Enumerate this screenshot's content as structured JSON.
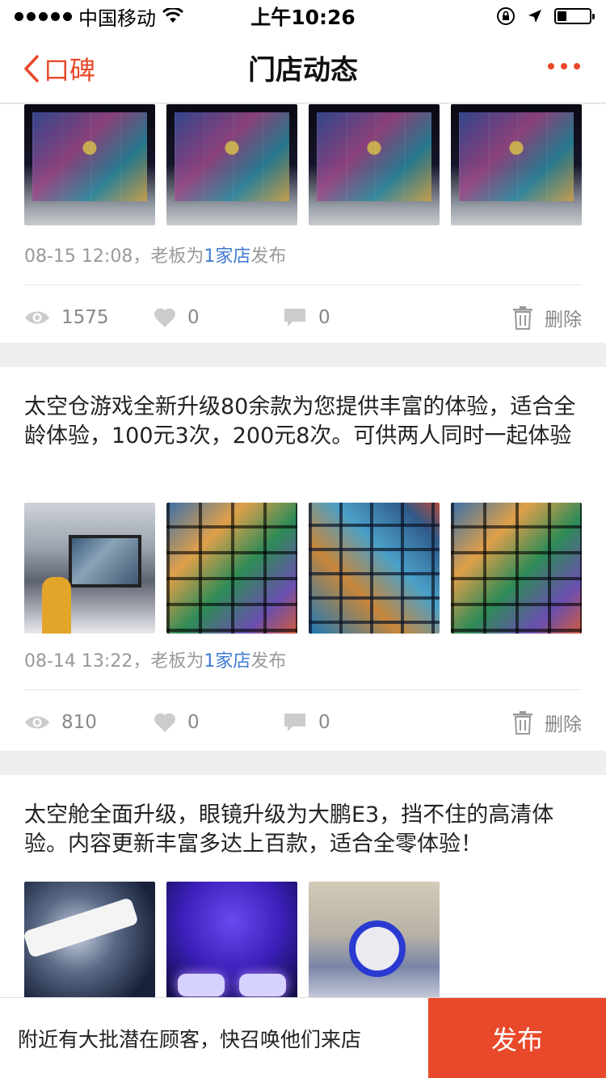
{
  "status_bar": {
    "carrier": "中国移动",
    "time": "上午10:26"
  },
  "nav": {
    "back_label": "口碑",
    "title": "门店动态"
  },
  "posts": [
    {
      "text": "",
      "meta_date": "08-15 12:08，老板为",
      "meta_store": "1家店",
      "meta_suffix": "发布",
      "views": "1575",
      "likes": "0",
      "comments": "0",
      "delete_label": "删除"
    },
    {
      "text": "太空仓游戏全新升级80余款为您提供丰富的体验，适合全龄体验，100元3次，200元8次。可供两人同时一起体验",
      "meta_date": "08-14 13:22，老板为",
      "meta_store": "1家店",
      "meta_suffix": "发布",
      "views": "810",
      "likes": "0",
      "comments": "0",
      "delete_label": "删除"
    },
    {
      "text": "太空舱全面升级，眼镜升级为大鹏E3，挡不住的高清体验。内容更新丰富多达上百款，适合全零体验！"
    }
  ],
  "bottom_bar": {
    "prompt": "附近有大批潜在顾客，快召唤他们来店",
    "publish_label": "发布"
  },
  "colors": {
    "accent": "#e8492b",
    "link": "#3f7bd0",
    "muted": "#999999"
  },
  "battery_level": 0.3
}
